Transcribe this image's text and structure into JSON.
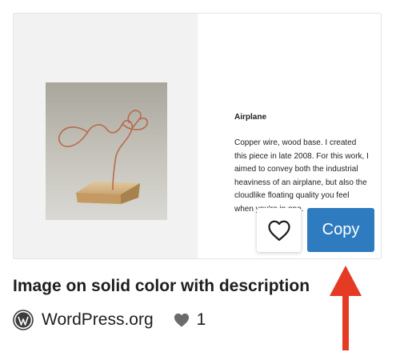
{
  "preview": {
    "title": "Airplane",
    "description": "Copper wire, wood base. I created this piece in late 2008. For this work, I aimed to convey both the industrial heaviness of an airplane, but also the cloudlike floating quality you feel when you're in one."
  },
  "actions": {
    "copy_label": "Copy",
    "favorite_icon": "heart-outline-icon"
  },
  "pattern": {
    "name": "Image on solid color with description",
    "author": "WordPress.org",
    "author_icon": "wordpress-logo-icon",
    "likes": "1",
    "likes_icon": "heart-filled-icon"
  },
  "annotation": {
    "arrow_color": "#e53b24",
    "arrow_icon": "arrow-up-icon"
  },
  "colors": {
    "copy_button": "#2f7bbf",
    "preview_background": "#f2f2f2"
  }
}
